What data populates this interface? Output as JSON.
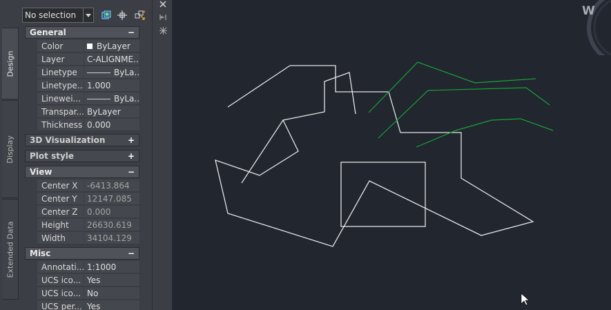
{
  "selection": {
    "value": "No selection"
  },
  "tabs": [
    "Design",
    "Display",
    "Extended Data"
  ],
  "sections": {
    "general": {
      "title": "General",
      "sign": "−"
    },
    "visualization": {
      "title": "3D Visualization",
      "sign": "+"
    },
    "plot_style": {
      "title": "Plot style",
      "sign": "+"
    },
    "view": {
      "title": "View",
      "sign": "−"
    },
    "misc": {
      "title": "Misc",
      "sign": "−"
    }
  },
  "general": [
    {
      "label": "Color",
      "value": "ByLayer"
    },
    {
      "label": "Layer",
      "value": "C-ALIGNME..."
    },
    {
      "label": "Linetype",
      "value": "ByLa..."
    },
    {
      "label": "Linetype...",
      "value": "1.000"
    },
    {
      "label": "Linewei...",
      "value": "ByLa..."
    },
    {
      "label": "Transpar...",
      "value": "ByLayer"
    },
    {
      "label": "Thickness",
      "value": "0.000"
    }
  ],
  "view": [
    {
      "label": "Center X",
      "value": "-6413.864"
    },
    {
      "label": "Center Y",
      "value": "12147.085"
    },
    {
      "label": "Center Z",
      "value": "0.000"
    },
    {
      "label": "Height",
      "value": "26630.619"
    },
    {
      "label": "Width",
      "value": "34104.129"
    }
  ],
  "misc": [
    {
      "label": "Annotati...",
      "value": "1:1000"
    },
    {
      "label": "UCS ico...",
      "value": "Yes"
    },
    {
      "label": "UCS ico...",
      "value": "No"
    },
    {
      "label": "UCS per...",
      "value": "Yes"
    }
  ],
  "viewcube": {
    "label": "W"
  },
  "colors": {
    "canvas": "#21262f",
    "panel": "#3b3e44",
    "geometry_white": "#e6e6e6",
    "geometry_green": "#19a338"
  },
  "icons": [
    "quick-select-icon",
    "select-objects-icon",
    "toggle-pickadd-icon",
    "close-icon",
    "auto-hide-icon",
    "properties-settings-icon",
    "cursor-arrow-icon"
  ]
}
